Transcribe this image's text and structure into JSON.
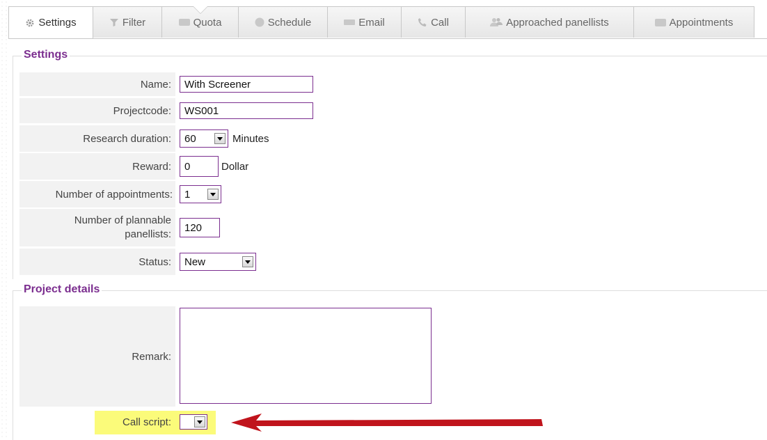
{
  "tabs": [
    {
      "label": "Settings",
      "icon": "gear-icon",
      "active": true
    },
    {
      "label": "Filter",
      "icon": "funnel-icon",
      "active": false
    },
    {
      "label": "Quota",
      "icon": "square-icon",
      "active": false
    },
    {
      "label": "Schedule",
      "icon": "circle-icon",
      "active": false
    },
    {
      "label": "Email",
      "icon": "envelope-icon",
      "active": false
    },
    {
      "label": "Call",
      "icon": "phone-icon",
      "active": false
    },
    {
      "label": "Approached panellists",
      "icon": "people-icon",
      "active": false
    },
    {
      "label": "Appointments",
      "icon": "calendar-icon",
      "active": false
    }
  ],
  "settings": {
    "legend": "Settings",
    "name": {
      "label": "Name:",
      "value": "With Screener"
    },
    "projectcode": {
      "label": "Projectcode:",
      "value": "WS001"
    },
    "duration": {
      "label": "Research duration:",
      "value": "60",
      "unit": "Minutes"
    },
    "reward": {
      "label": "Reward:",
      "value": "0",
      "unit": "Dollar"
    },
    "appointments": {
      "label": "Number of appointments:",
      "value": "1"
    },
    "plannable": {
      "label_line1": "Number of plannable",
      "label_line2": "panellists:",
      "value": "120"
    },
    "status": {
      "label": "Status:",
      "value": "New"
    }
  },
  "details": {
    "legend": "Project details",
    "remark": {
      "label": "Remark:",
      "value": ""
    },
    "callscript": {
      "label": "Call script:",
      "value": ""
    }
  },
  "colors": {
    "accent": "#7b2e8f",
    "highlight": "#fbfb7a",
    "arrow": "#c0141c"
  }
}
